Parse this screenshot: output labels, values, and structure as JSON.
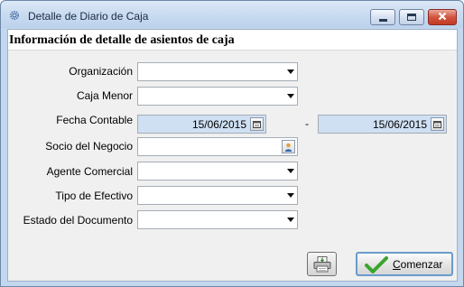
{
  "window": {
    "title": "Detalle de Diario de Caja"
  },
  "form": {
    "header": "Información de detalle de asientos de caja",
    "labels": {
      "organization": "Organización",
      "petty_cash": "Caja Menor",
      "accounting_date": "Fecha Contable",
      "business_partner": "Socio del Negocio",
      "sales_agent": "Agente Comercial",
      "cash_type": "Tipo de Efectivo",
      "document_status": "Estado del Documento"
    },
    "values": {
      "date_from": "15/06/2015",
      "date_to": "15/06/2015",
      "range_separator": "-"
    }
  },
  "buttons": {
    "start_mnemonic": "C",
    "start_rest": "omenzar"
  },
  "colors": {
    "title_bar": "#c6d9ef",
    "close_button": "#c13a25",
    "date_field_bg": "#cfe0f3",
    "check_green": "#3aa52c"
  }
}
